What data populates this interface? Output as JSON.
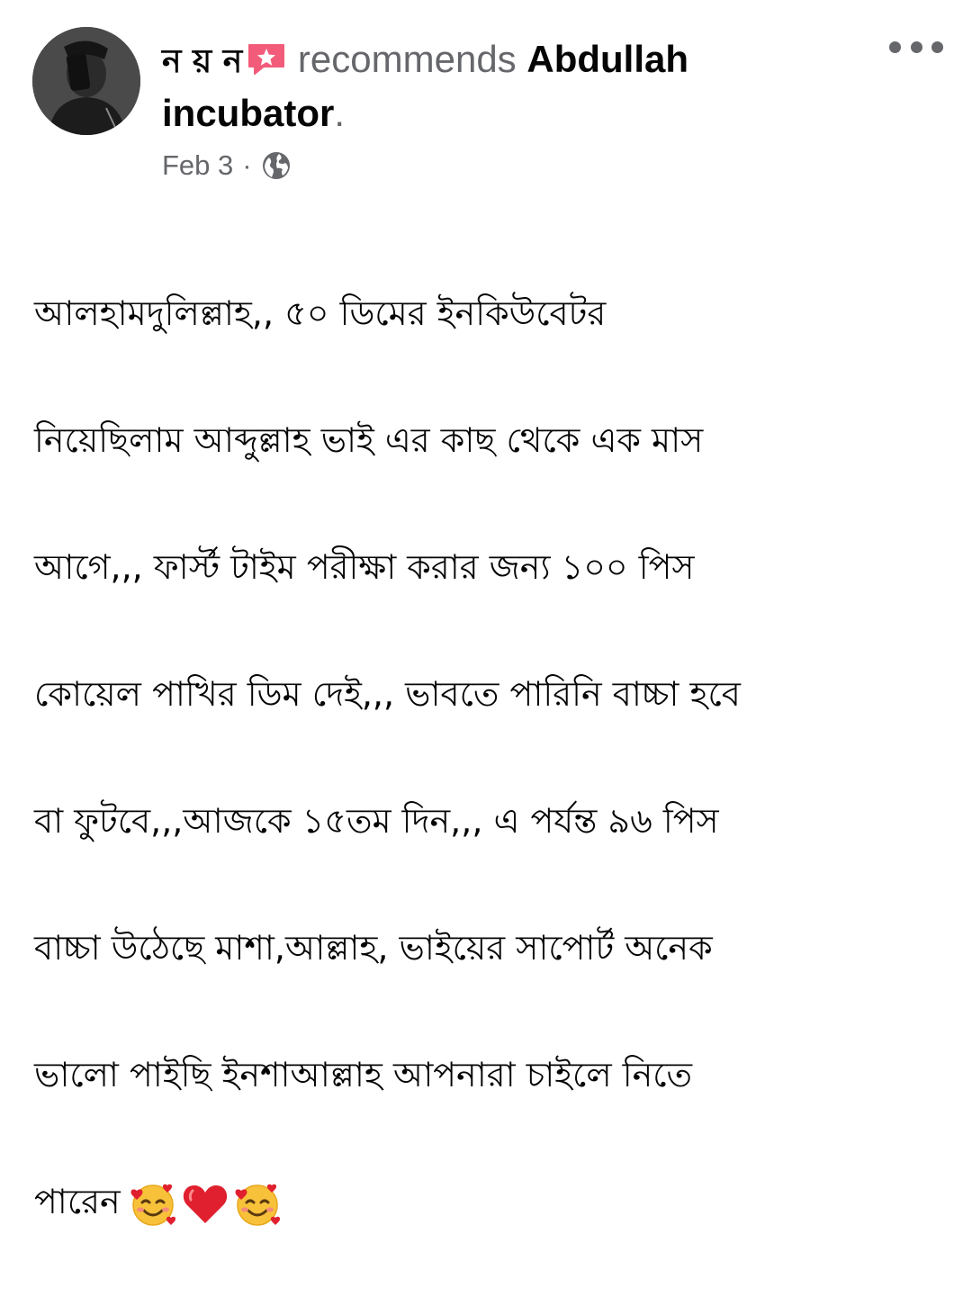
{
  "post": {
    "author_name": "ন য় ন",
    "verb": "recommends",
    "page_name_line1": "Abdullah",
    "page_name_line2": "incubator",
    "period": ".",
    "date": "Feb 3",
    "separator": "·",
    "privacy_icon": "globe-icon",
    "badge_icon": "star-badge-icon",
    "more_icon": "more-options-icon",
    "body_lines": [
      "আলহামদুলিল্লাহ,, ৫০ ডিমের ইনকিউবেটর",
      "নিয়েছিলাম আব্দুল্লাহ ভাই এর কাছ থেকে এক মাস",
      "আগে,,, ফার্স্ট টাইম পরীক্ষা করার জন্য ১০০ পিস",
      "কোয়েল পাখির ডিম দেই,,, ভাবতে পারিনি বাচ্চা হবে",
      "বা ফুটবে,,,আজকে ১৫তম দিন,,, এ পর্যন্ত ৯৬ পিস",
      "বাচ্চা উঠেছে মাশা,আল্লাহ, ভাইয়ের সাপোর্ট অনেক",
      "ভালো পাইছি ইনশাআল্লাহ আপনারা চাইলে নিতে",
      "পারেন"
    ],
    "emojis": [
      "smiling-face-with-hearts-icon",
      "red-heart-icon",
      "smiling-face-with-hearts-icon"
    ]
  },
  "colors": {
    "text_primary": "#050505",
    "text_secondary": "#65676b",
    "badge_pink": "#f25c7a",
    "heart_red": "#e0202e"
  }
}
